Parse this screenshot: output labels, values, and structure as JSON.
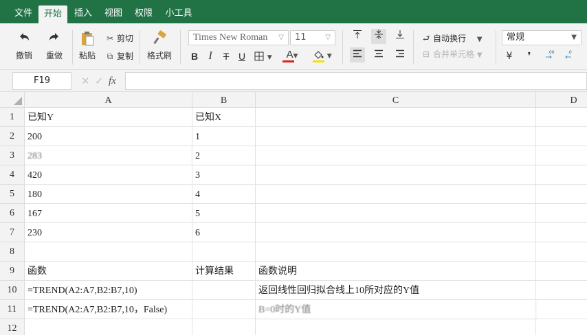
{
  "menu": {
    "items": [
      "文件",
      "开始",
      "插入",
      "视图",
      "权限",
      "小工具"
    ],
    "active_index": 1
  },
  "ribbon": {
    "undo": "撤销",
    "redo": "重做",
    "paste": "粘贴",
    "cut": "剪切",
    "copy": "复制",
    "format_painter": "格式刷",
    "font_name": "Times New Roman",
    "font_size": "11",
    "bold": "B",
    "italic": "I",
    "strike": "T",
    "underline": "U",
    "font_color_glyph": "A",
    "wrap_text": "自动换行",
    "merge_cells": "合并单元格",
    "number_format": "常规",
    "currency_glyph": "¥",
    "comma_glyph": "❜",
    "colors": {
      "font_color_bar": "#e02020",
      "fill_color_bar": "#f5e100",
      "accent": "#217346"
    }
  },
  "formula_bar": {
    "cell_ref": "F19",
    "fx": "fx",
    "cancel_glyph": "✕",
    "confirm_glyph": "✓",
    "value": ""
  },
  "sheet": {
    "columns": [
      "A",
      "B",
      "C",
      "D"
    ],
    "rows": [
      "1",
      "2",
      "3",
      "4",
      "5",
      "6",
      "7",
      "8",
      "9",
      "10",
      "11",
      "12"
    ],
    "cells": {
      "A1": "已知Y",
      "B1": "已知X",
      "A2": "200",
      "B2": "1",
      "A3": "283",
      "B3": "2",
      "A4": "420",
      "B4": "3",
      "A5": "180",
      "B5": "4",
      "A6": "167",
      "B6": "5",
      "A7": "230",
      "B7": "6",
      "A9": "函数",
      "B9": "计算结果",
      "C9": "函数说明",
      "A10": "=TREND(A2:A7,B2:B7,10)",
      "C10": "返回线性回归拟合线上10所对应的Y值",
      "A11": "=TREND(A2:A7,B2:B7,10，False)",
      "C11": "B=0时的Y值"
    }
  }
}
